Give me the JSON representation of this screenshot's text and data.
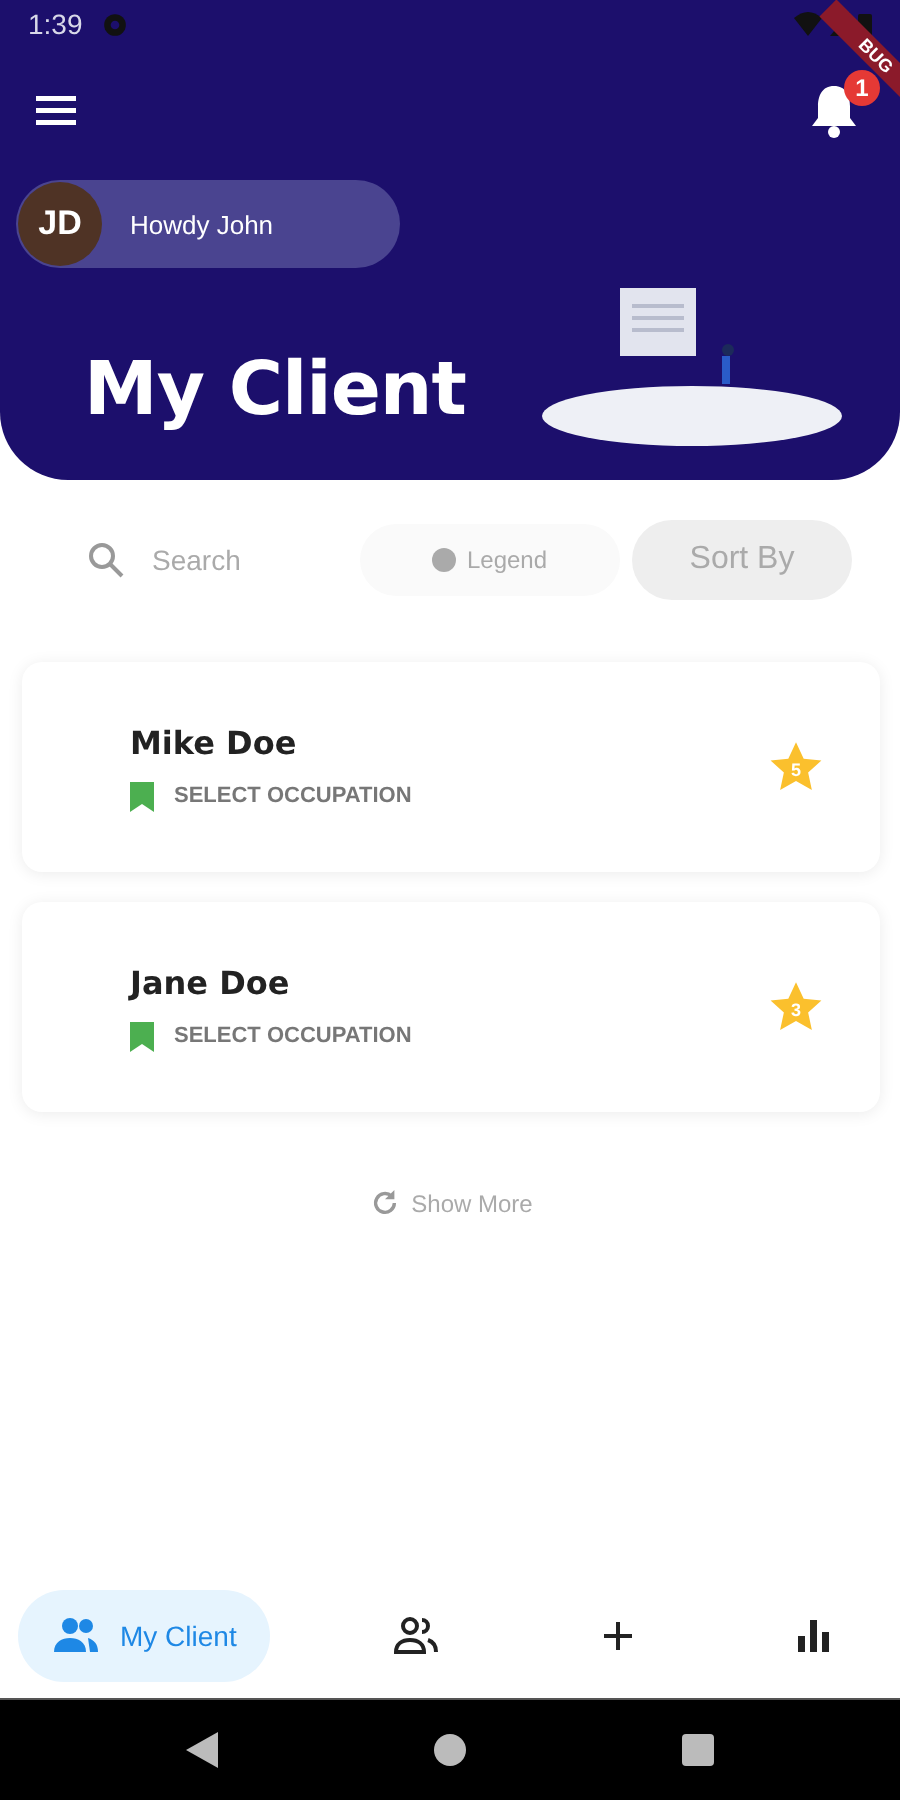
{
  "status_bar": {
    "time": "1:39"
  },
  "debug_banner": {
    "label": "BUG"
  },
  "header": {
    "notification_count": "1",
    "user": {
      "initials": "JD",
      "greeting": "Howdy John"
    },
    "title": "My Client"
  },
  "toolbar": {
    "search": {
      "placeholder": "Search"
    },
    "legend": "Legend",
    "sort": "Sort By"
  },
  "clients": [
    {
      "name": "Mike Doe",
      "occupation": "SELECT OCCUPATION",
      "rating": "5"
    },
    {
      "name": "Jane Doe",
      "occupation": "SELECT OCCUPATION",
      "rating": "3"
    }
  ],
  "show_more": "Show More",
  "bottom_nav": [
    {
      "kind": "clients",
      "label": "My Client",
      "selected": true
    },
    {
      "kind": "team",
      "selected": false
    },
    {
      "kind": "add",
      "selected": false
    },
    {
      "kind": "stats",
      "selected": false
    }
  ]
}
